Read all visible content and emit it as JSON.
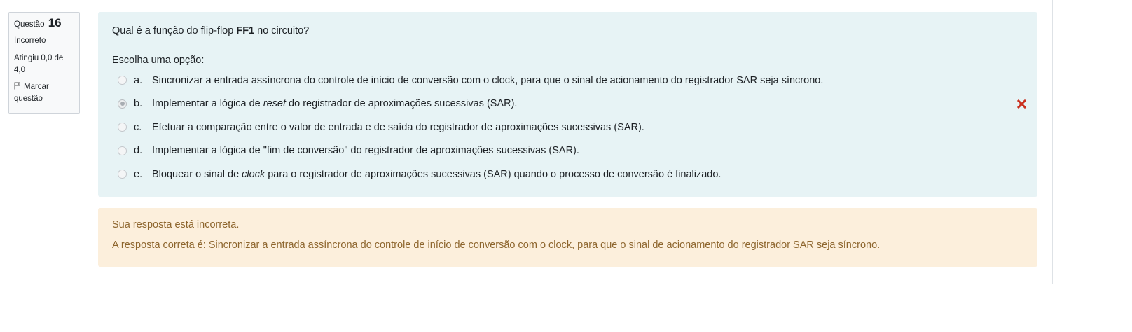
{
  "question_info": {
    "label": "Questão",
    "number": "16",
    "state": "Incorreto",
    "grade": "Atingiu 0,0 de 4,0",
    "flag_label": "Marcar questão"
  },
  "question": {
    "text_before": "Qual é a função do flip-flop ",
    "text_bold": "FF1",
    "text_after": " no circuito?",
    "prompt": "Escolha uma opção:",
    "answers": [
      {
        "letter": "a.",
        "pre": "Sincronizar a entrada assíncrona do controle de início de conversão com o clock, para que o sinal de acionamento do registrador SAR seja síncrono.",
        "em": "",
        "post": "",
        "selected": false
      },
      {
        "letter": "b.",
        "pre": "Implementar a lógica de ",
        "em": "reset",
        "post": " do registrador de aproximações sucessivas (SAR).",
        "selected": true,
        "incorrect_icon": "red-x-icon"
      },
      {
        "letter": "c.",
        "pre": "Efetuar a comparação entre o valor de entrada e de saída do registrador de aproximações sucessivas (SAR).",
        "em": "",
        "post": "",
        "selected": false
      },
      {
        "letter": "d.",
        "pre": "Implementar a lógica de \"fim de conversão\" do registrador de aproximações sucessivas (SAR).",
        "em": "",
        "post": "",
        "selected": false
      },
      {
        "letter": "e.",
        "pre": "Bloquear o sinal de ",
        "em": "clock",
        "post": " para o registrador de aproximações sucessivas (SAR) quando o processo de conversão é finalizado.",
        "selected": false
      }
    ]
  },
  "feedback": {
    "status": "Sua resposta está incorreta.",
    "correct_answer": "A resposta correta é: Sincronizar a entrada assíncrona do controle de início de conversão com o clock, para que o sinal de acionamento do registrador SAR seja síncrono."
  },
  "colors": {
    "formulation_bg": "#e7f3f5",
    "feedback_bg": "#fcefdc",
    "feedback_text": "#8e662e",
    "incorrect_icon": "#ca3120"
  }
}
